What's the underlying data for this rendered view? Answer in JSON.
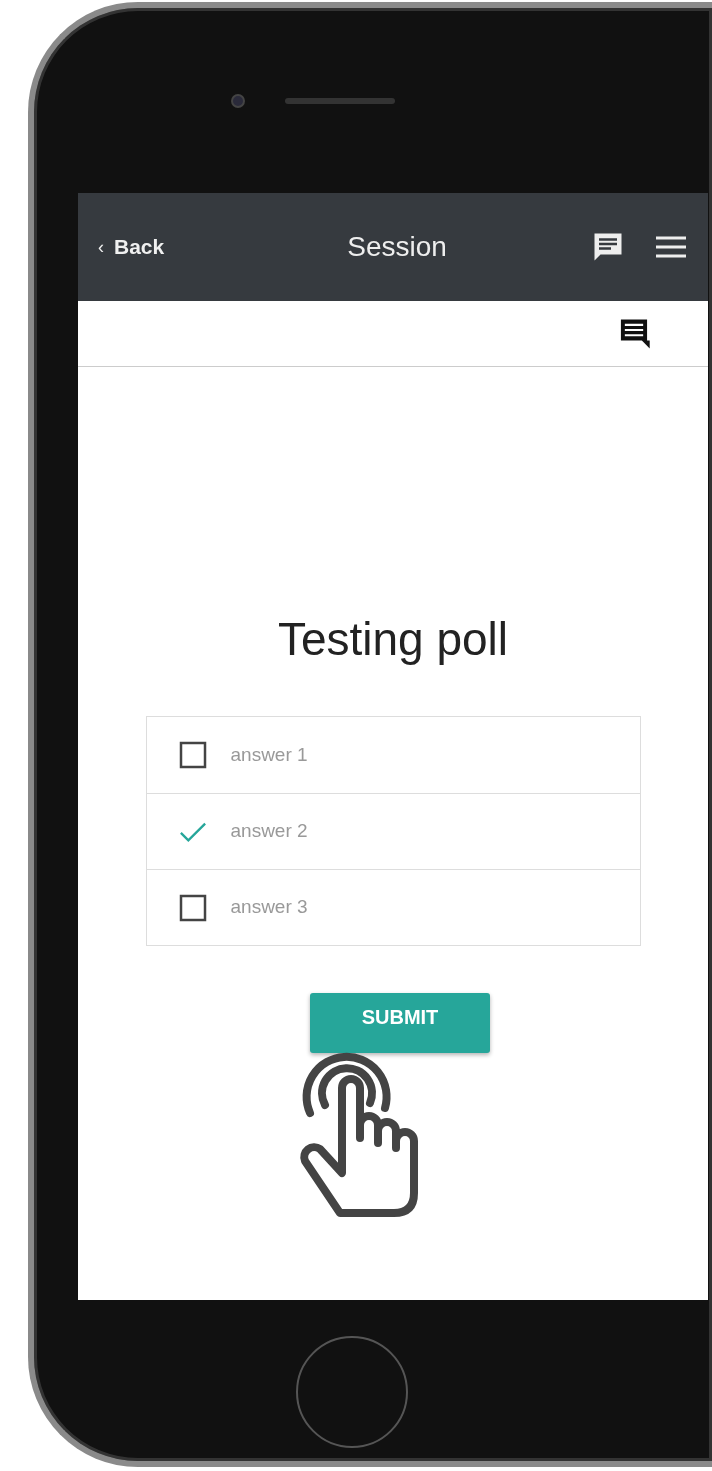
{
  "navbar": {
    "back_glyph": "‹",
    "back_label": "Back",
    "title": "Session"
  },
  "poll": {
    "title": "Testing poll",
    "answers": [
      {
        "label": "answer 1",
        "checked": false
      },
      {
        "label": "answer 2",
        "checked": true
      },
      {
        "label": "answer 3",
        "checked": false
      }
    ],
    "submit_label": "SUBMIT"
  }
}
